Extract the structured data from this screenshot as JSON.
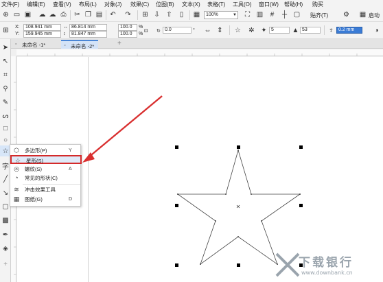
{
  "menu": [
    "文件(F)",
    "编辑(E)",
    "查看(V)",
    "布局(L)",
    "对象(J)",
    "效果(C)",
    "位图(B)",
    "文本(X)",
    "表格(T)",
    "工具(O)",
    "窗口(W)",
    "帮助(H)",
    "购买"
  ],
  "toolbar": {
    "zoom": "100%",
    "snap_label": "贴齐(T)",
    "launch_label": "启动"
  },
  "properties": {
    "x_label": "X:",
    "y_label": "Y:",
    "x": "108.941 mm",
    "y": "159.945 mm",
    "width": "86.814 mm",
    "height": "81.847 mm",
    "scale_w": "100.0",
    "scale_h": "100.0",
    "pct": "%",
    "rotation": "0.0",
    "rotation_unit": "°",
    "points": "5",
    "sharpness": "53",
    "outline": "0.2 mm"
  },
  "tabs": [
    "未命名 -1*",
    "未命名 -2*"
  ],
  "tab_add": "+",
  "flyout": [
    {
      "icon": "polygon-icon",
      "label": "多边形(P)",
      "key": "Y",
      "highlighted": false
    },
    {
      "icon": "star-icon",
      "label": "星形(S)",
      "key": "",
      "highlighted": true
    },
    {
      "icon": "spiral-icon",
      "label": "螺纹(S)",
      "key": "A",
      "highlighted": false
    },
    {
      "icon": "common-shapes-icon",
      "label": "常见的形状(C)",
      "key": "",
      "highlighted": false
    },
    {
      "icon": "impact-tool-icon",
      "label": "冲击效果工具",
      "key": "",
      "highlighted": false
    },
    {
      "icon": "graph-paper-icon",
      "label": "图纸(G)",
      "key": "D",
      "highlighted": false
    }
  ],
  "colors": {
    "accent": "#4a86d6",
    "highlight_border": "#d42a2a",
    "arrow": "#d93030"
  },
  "watermark": {
    "cn": "下载银行",
    "en": "www.downbank.cn"
  }
}
